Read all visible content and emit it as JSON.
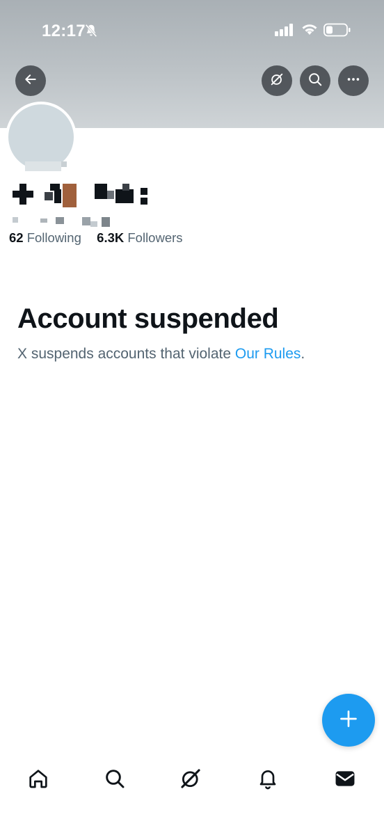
{
  "status_bar": {
    "time": "12:17",
    "bell_icon": "bell-slash-icon",
    "signal_icon": "cellular-signal-icon",
    "wifi_icon": "wifi-icon",
    "battery_icon": "battery-low-icon"
  },
  "header": {
    "back_icon": "arrow-left-icon",
    "grok_icon": "grok-icon",
    "search_icon": "search-icon",
    "more_icon": "more-horizontal-icon"
  },
  "profile": {
    "following_count": "62",
    "following_label": "Following",
    "followers_count": "6.3K",
    "followers_label": "Followers"
  },
  "suspension": {
    "title": "Account suspended",
    "text": "X suspends accounts that violate ",
    "link": "Our Rules",
    "end": "."
  },
  "fab": {
    "icon": "plus-icon"
  },
  "bottom_nav": [
    {
      "icon": "home-icon"
    },
    {
      "icon": "search-icon"
    },
    {
      "icon": "grok-icon"
    },
    {
      "icon": "bell-icon"
    },
    {
      "icon": "envelope-icon"
    }
  ],
  "colors": {
    "accent": "#1d9bf0",
    "primary_text": "#0f1419",
    "secondary_text": "#536471",
    "banner": "#bcc2c6"
  }
}
